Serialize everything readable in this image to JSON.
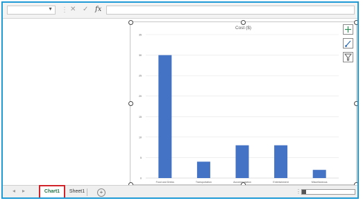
{
  "formula_bar": {
    "name_box_value": "",
    "formula_value": "",
    "cancel_symbol": "✕",
    "enter_symbol": "✓",
    "fx_label": "fx"
  },
  "chart_data": {
    "type": "bar",
    "title": "Cost ($)",
    "categories": [
      "Food and Drinks",
      "Transportation",
      "Accommodation",
      "Entertainment",
      "Miscellaneous"
    ],
    "values": [
      30,
      4,
      8,
      8,
      2
    ],
    "ylim": [
      0,
      35
    ],
    "yticks": [
      "0",
      "5",
      "10",
      "15",
      "20",
      "25",
      "30",
      "35"
    ],
    "bar_color": "#4472c4",
    "grid": true
  },
  "chart_buttons": {
    "elements_icon": "plus-icon",
    "styles_icon": "brush-icon",
    "filters_icon": "filter-icon"
  },
  "tabs": {
    "active": "Chart1",
    "items": [
      "Chart1",
      "Sheet1"
    ],
    "add_symbol": "+"
  },
  "colors": {
    "window_border": "#1e9bd7",
    "active_tab_highlight": "#d0232a",
    "active_tab_text": "#217346"
  }
}
